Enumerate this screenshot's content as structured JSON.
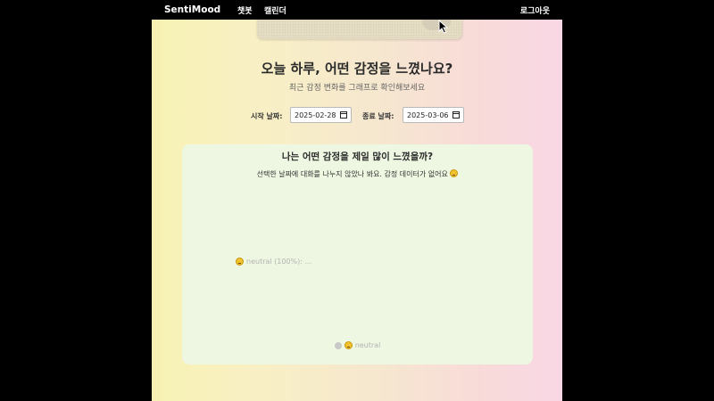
{
  "nav": {
    "brand": "SentiMood",
    "links": [
      "챗봇",
      "캘린더"
    ],
    "logout": "로그아웃"
  },
  "header": {
    "title": "오늘 하루, 어떤 감정을 느꼈나요?",
    "subtitle": "최근 감정 변화를 그래프로 확인해보세요"
  },
  "date_filter": {
    "start_label": "시작 날짜:",
    "start_value": "2025-02-28",
    "end_label": "종료 날짜:",
    "end_value": "2025-03-06"
  },
  "chart_card": {
    "title": "나는 어떤 감정을 제일 많이 느꼈을까?",
    "message": "선택한 날짜에 대화를 나누지 않았나 봐요. 감정 데이터가 없어요",
    "slice_label": "neutral (100%): ...",
    "legend_label": "neutral"
  },
  "chart_data": {
    "type": "pie",
    "categories": [
      "neutral"
    ],
    "values": [
      100
    ]
  },
  "colors": {
    "card_bg": "#eef7e1",
    "legend_swatch": "#c9c9c9"
  }
}
